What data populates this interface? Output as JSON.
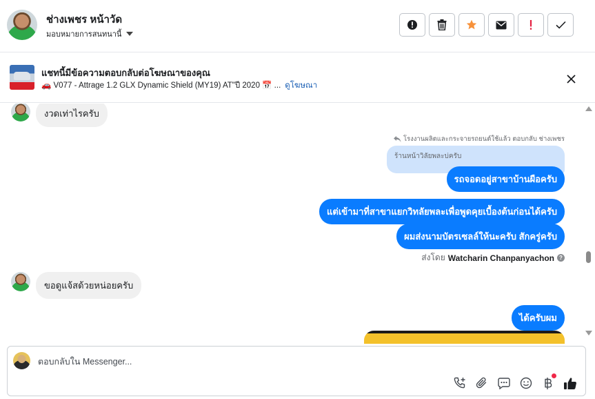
{
  "header": {
    "contact_name": "ช่างเพชร หน้าวัด",
    "assign_label": "มอบหมายการสนทนานี้",
    "actions": [
      {
        "name": "mark-spam",
        "icon": "alert-circle-icon"
      },
      {
        "name": "delete",
        "icon": "trash-icon"
      },
      {
        "name": "star",
        "icon": "star-icon"
      },
      {
        "name": "mark-unread",
        "icon": "envelope-icon"
      },
      {
        "name": "important",
        "icon": "exclamation-icon"
      },
      {
        "name": "done",
        "icon": "check-icon"
      }
    ],
    "star_color": "#f7923b",
    "important_color": "#e41e3f"
  },
  "ad": {
    "title": "แชทนี้มีข้อความตอบกลับต่อโฆษณาของคุณ",
    "subtitle": "🚗 V077 - Attrage 1.2 GLX Dynamic Shield (MY19) AT\"ปี 2020 📅 ...",
    "link_label": "ดูโฆษณา"
  },
  "messages": {
    "incoming_1": "งวดเท่าไรครับ",
    "reply_note": "โรงงานผลิตและกระจายรถยนต์ใช้แล้ว ตอบกลับ ช่างเพชร",
    "quoted_text": "ร้านหน้าวิลัยพละบ่ครับ",
    "outgoing_1": "รถจอดอยู่สาขาบ้านผือครับ",
    "outgoing_2": "แต่เข้ามาที่สาขาแยกวิทลัยพละเพื่อพูดคุยเบื้องต้นก่อนได้ครับ",
    "outgoing_3": "ผมส่งนามบัตรเซลล์ให้นะครับ สักครู่ครับ",
    "sent_by_prefix": "ส่งโดย",
    "sent_by_name": "Watcharin Chanpanyachon",
    "incoming_2": "ขอดูแจ้สด้วยหน่อยครับ",
    "outgoing_4": "ได้ครับผม"
  },
  "composer": {
    "placeholder": "ตอบกลับใน Messenger...",
    "icons": [
      "phone-add-icon",
      "paperclip-icon",
      "saved-replies-icon",
      "emoji-icon",
      "baht-icon",
      "thumbs-up-icon"
    ],
    "accent": "#0a7cff"
  }
}
